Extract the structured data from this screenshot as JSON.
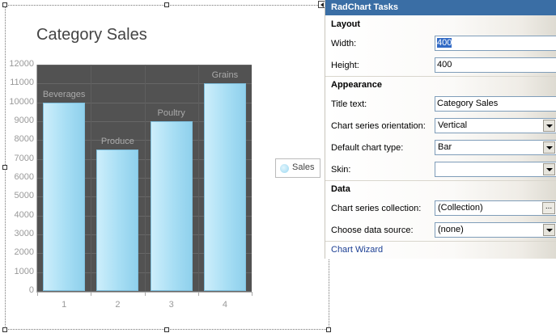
{
  "chart": {
    "title": "Category Sales",
    "legend_label": "Sales"
  },
  "chart_data": {
    "type": "bar",
    "title": "Category Sales",
    "categories": [
      "1",
      "2",
      "3",
      "4"
    ],
    "series": [
      {
        "name": "Sales",
        "values": [
          10000,
          7500,
          9000,
          11000
        ],
        "labels": [
          "Beverages",
          "Produce",
          "Poultry",
          "Grains"
        ]
      }
    ],
    "y_ticks": [
      "0",
      "1000",
      "2000",
      "3000",
      "4000",
      "5000",
      "6000",
      "7000",
      "8000",
      "9000",
      "10000",
      "11000",
      "12000"
    ],
    "ylim": [
      0,
      12000
    ],
    "xlabel": "",
    "ylabel": "",
    "legend": "right",
    "colors": {
      "bar": "#a7def4",
      "plot_bg": "#525252"
    }
  },
  "tasks": {
    "header": "RadChart Tasks",
    "layout_title": "Layout",
    "width_label": "Width:",
    "width_value": "400",
    "height_label": "Height:",
    "height_value": "400",
    "appearance_title": "Appearance",
    "title_text_label": "Title text:",
    "title_text_value": "Category Sales",
    "orientation_label": "Chart series orientation:",
    "orientation_value": "Vertical",
    "chart_type_label": "Default chart type:",
    "chart_type_value": "Bar",
    "skin_label": "Skin:",
    "skin_value": "",
    "data_title": "Data",
    "series_collection_label": "Chart series collection:",
    "series_collection_value": "(Collection)",
    "ellipsis": "...",
    "data_source_label": "Choose data source:",
    "data_source_value": "(none)",
    "wizard_link": "Chart Wizard"
  }
}
